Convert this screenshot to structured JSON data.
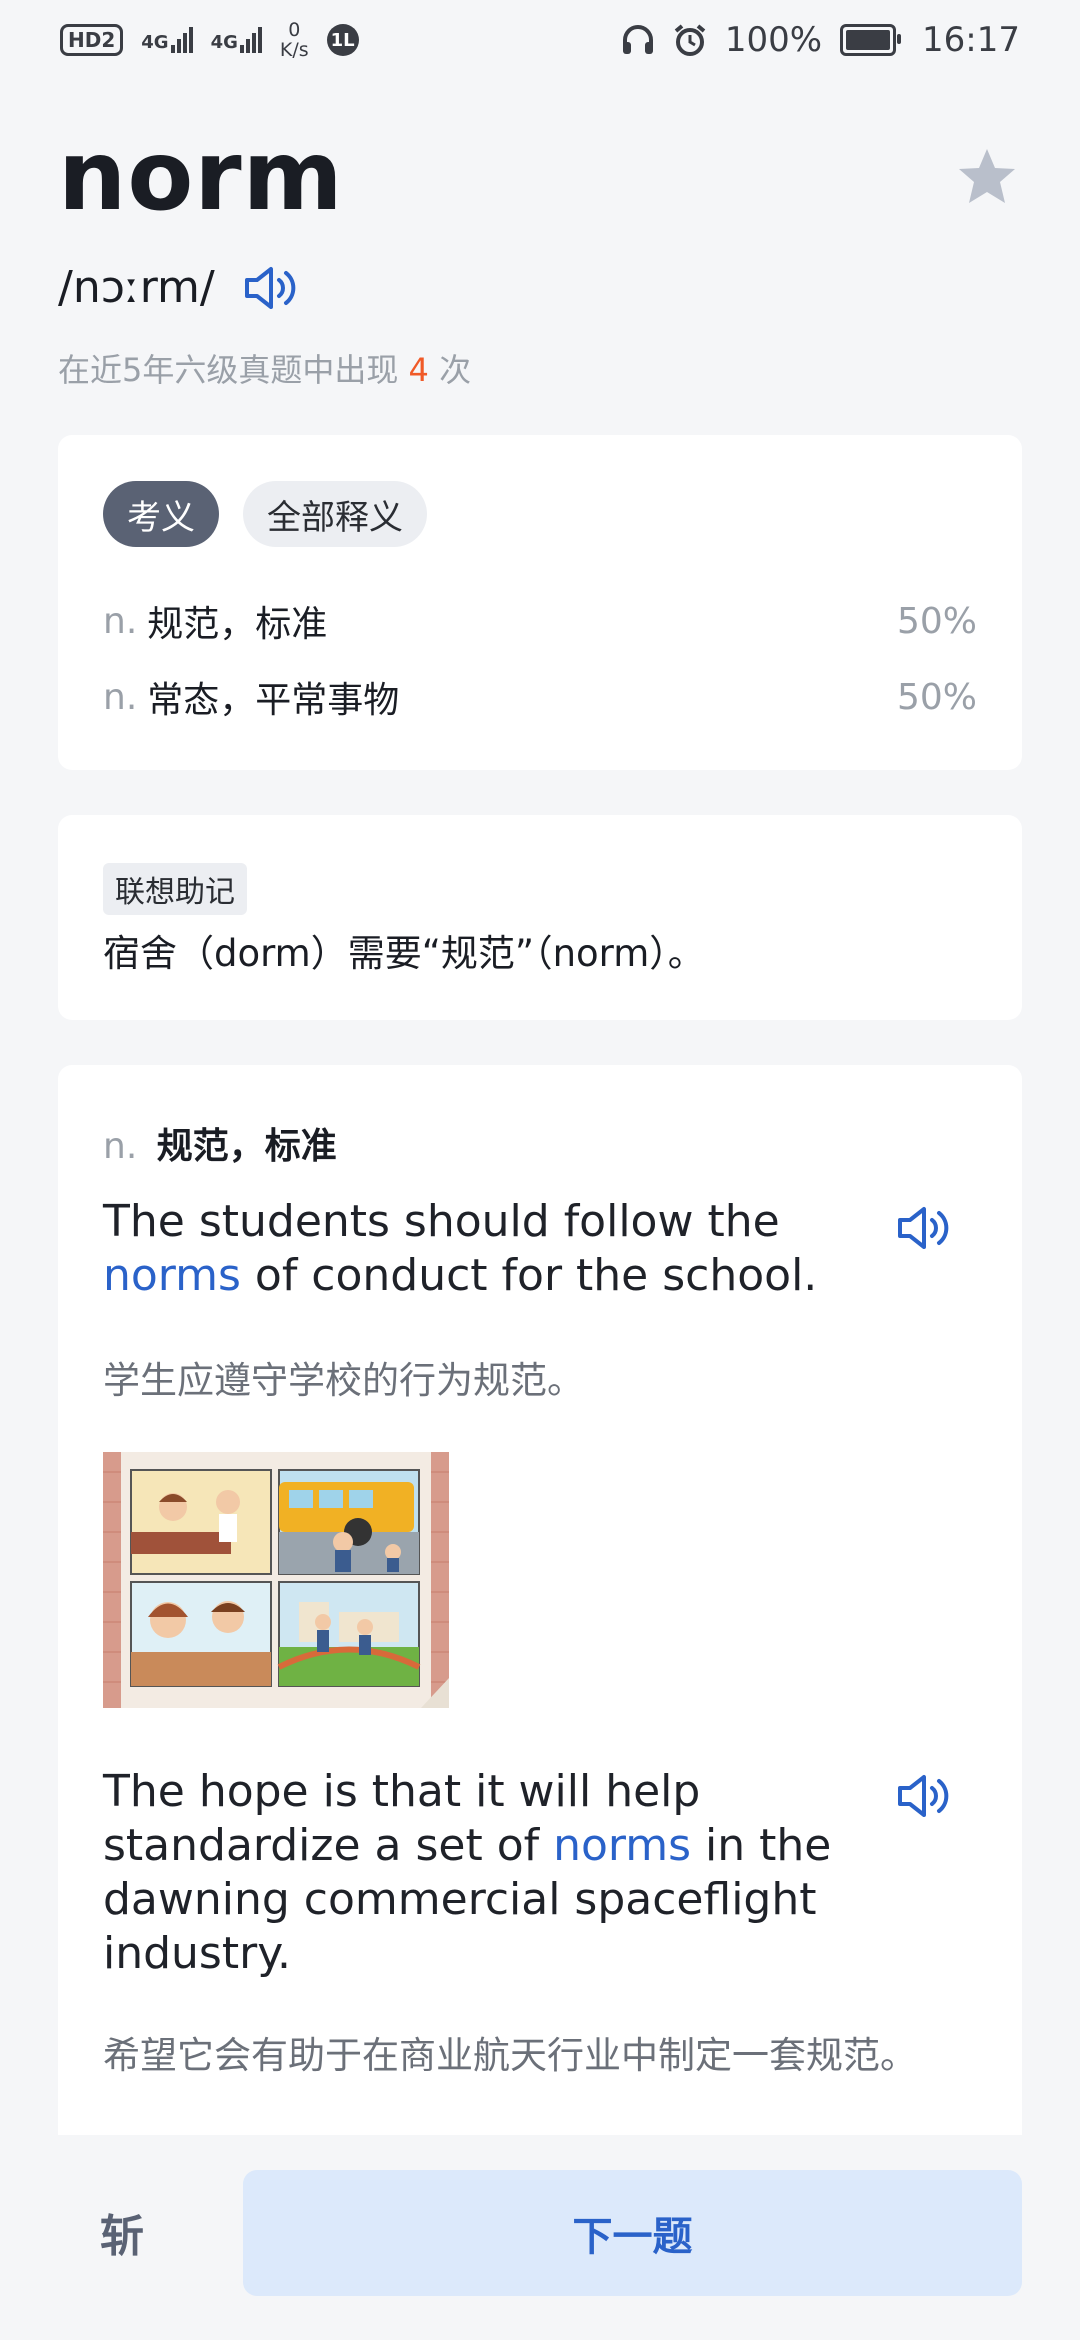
{
  "status_bar": {
    "hd": "HD",
    "sim": "2",
    "net1": "4G",
    "net2": "4G",
    "speed_value": "0",
    "speed_unit": "K/s",
    "badge": "1L",
    "battery": "100%",
    "time": "16:17"
  },
  "word": {
    "title": "norm",
    "phonetic": "/nɔːrm/",
    "exam_note_prefix": "在近5年六级真题中出现 ",
    "exam_note_count": "4",
    "exam_note_suffix": " 次"
  },
  "definitions": {
    "tabs": [
      {
        "label": "考义",
        "active": true
      },
      {
        "label": "全部释义",
        "active": false
      }
    ],
    "items": [
      {
        "pos": "n.",
        "meaning": "规范，标准",
        "pct": "50%"
      },
      {
        "pos": "n.",
        "meaning": "常态，平常事物",
        "pct": "50%"
      }
    ]
  },
  "mnemonic": {
    "tag": "联想助记",
    "text": "宿舍（dorm）需要“规范”（norm）。"
  },
  "examples": {
    "pos": "n.",
    "meaning": "规范，标准",
    "items": [
      {
        "en_before": "The students should follow the ",
        "en_highlight": "norms",
        "en_after": " of conduct for the school.",
        "cn": "学生应遵守学校的行为规范。"
      },
      {
        "en_before": "The hope is that it will help standardize a set of ",
        "en_highlight": "norms",
        "en_after": " in the dawning commercial spaceflight industry.",
        "cn": "希望它会有助于在商业航天行业中制定一套规范。"
      }
    ]
  },
  "bottom": {
    "skip_label": "斩",
    "next_label": "下一题"
  },
  "colors": {
    "accent": "#2a62c9",
    "count": "#f05a28",
    "tab_active": "#5a6274",
    "next_bg": "#dce9fb"
  }
}
